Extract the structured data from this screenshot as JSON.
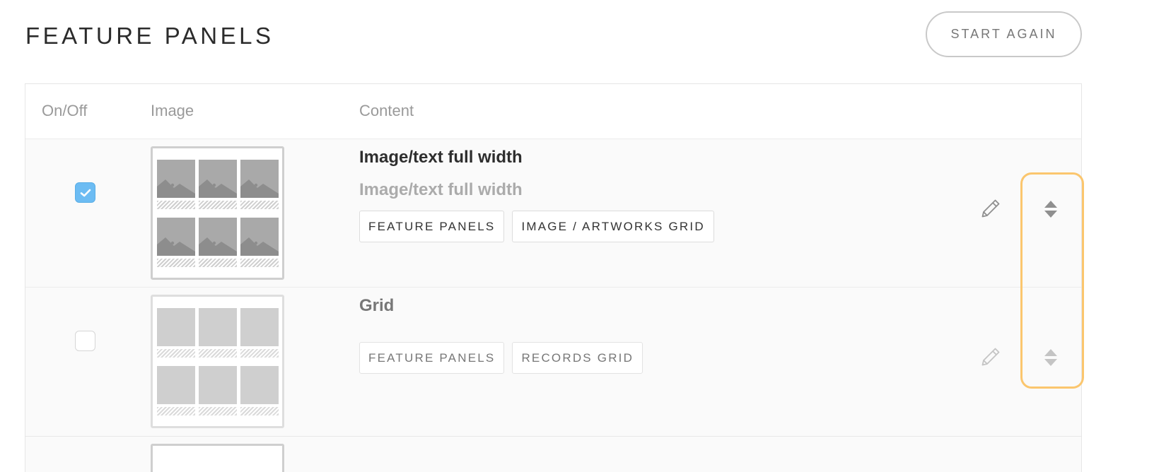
{
  "header": {
    "title": "FEATURE PANELS",
    "start_again_label": "START AGAIN"
  },
  "table": {
    "columns": {
      "on_off": "On/Off",
      "image": "Image",
      "content": "Content"
    },
    "rows": [
      {
        "enabled": true,
        "title": "Image/text full width",
        "subtitle": "Image/text full width",
        "thumbnail": "image-grid-icon",
        "tags": [
          "FEATURE PANELS",
          "IMAGE / ARTWORKS GRID"
        ]
      },
      {
        "enabled": false,
        "title": "Grid",
        "subtitle": "",
        "thumbnail": "grid-icon",
        "tags": [
          "FEATURE PANELS",
          "RECORDS GRID"
        ]
      }
    ]
  },
  "colors": {
    "checkbox_on": "#6cbcf3",
    "highlight": "#fbc66e"
  }
}
